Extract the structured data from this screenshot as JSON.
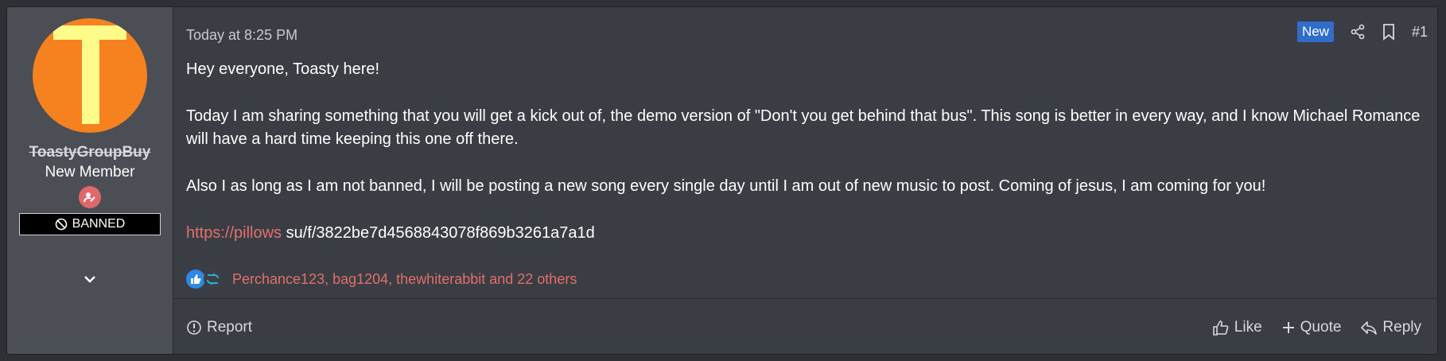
{
  "user": {
    "username": "ToastyGroupBuy",
    "title": "New Member",
    "banned_label": "BANNED",
    "avatar_letter": "T"
  },
  "post": {
    "timestamp": "Today at 8:25 PM",
    "badge": "New",
    "number": "#1",
    "paragraphs": [
      "Hey everyone, Toasty here!",
      "Today I am sharing something that you will get a kick out of, the demo version of \"Don't you get behind that bus\". This song is better in every way, and I know Michael Romance will have a hard time keeping this one off there.",
      "Also I as long as I am not banned, I will be posting a new song every single day until I am out of new music to post. Coming of jesus, I am coming for you!"
    ],
    "link_part1": "https://pillows",
    "link_part2": " su/f/3822be7d4568843078f869b3261a7a1d"
  },
  "reactions": {
    "names": "Perchance123, bag1204, thewhiterabbit and 22 others"
  },
  "footer": {
    "report": "Report",
    "like": "Like",
    "quote": "Quote",
    "reply": "Reply"
  },
  "colors": {
    "accent_link": "#e26f6a",
    "badge_new": "#2f6dc9",
    "avatar_bg": "#f5821f"
  }
}
